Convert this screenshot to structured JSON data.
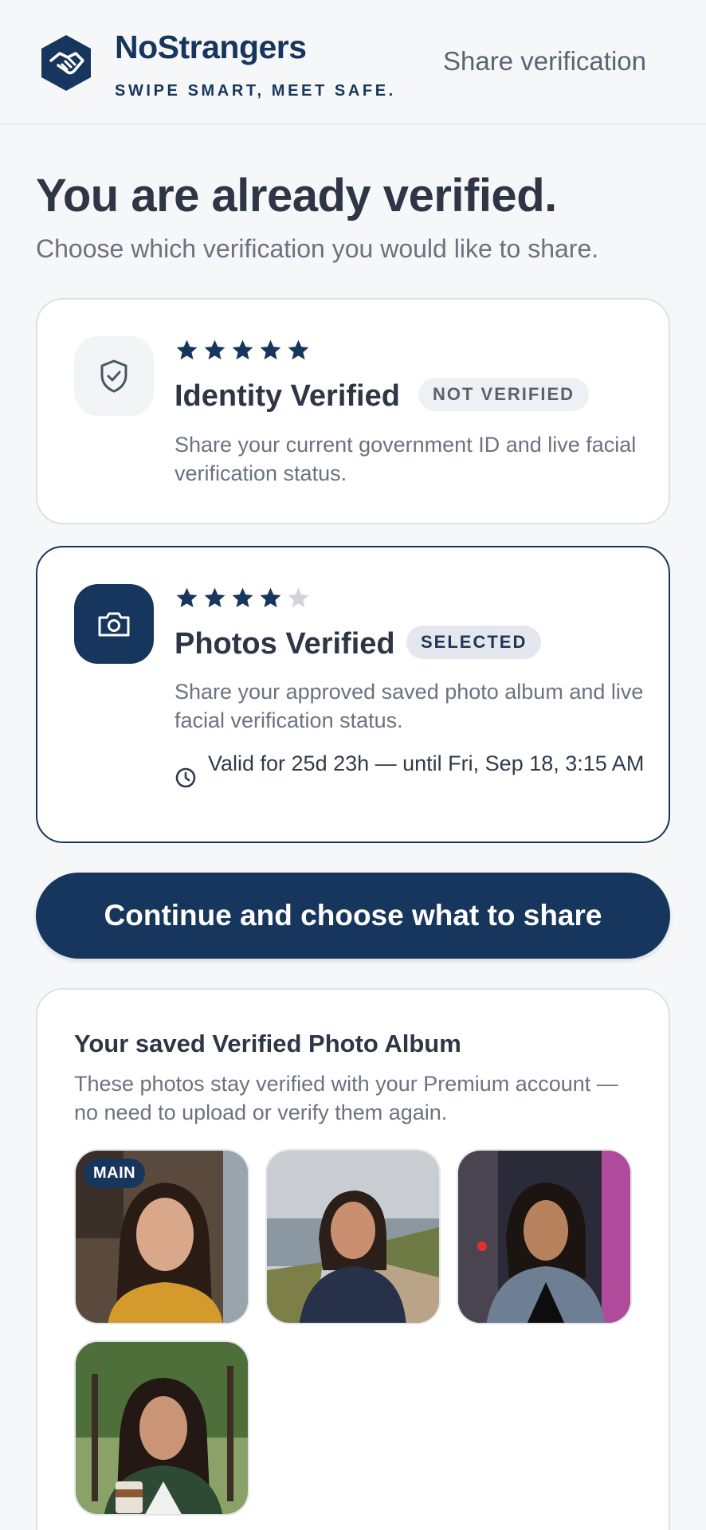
{
  "header": {
    "brand_name": "NoStrangers",
    "brand_tagline": "SWIPE SMART, MEET SAFE.",
    "share_link": "Share verification"
  },
  "main": {
    "title": "You are already verified.",
    "subtitle": "Choose which verification you would like to share."
  },
  "cards": [
    {
      "title": "Identity Verified",
      "badge": "NOT VERIFIED",
      "description": "Share your current government ID and live facial verification status.",
      "stars_filled": 5,
      "stars_total": 5,
      "icon": "shield-check-icon"
    },
    {
      "title": "Photos Verified",
      "badge": "SELECTED",
      "description": "Share your approved saved photo album and live facial verification status.",
      "valid_text": "Valid for 25d 23h — until Fri, Sep 18, 3:15 AM",
      "stars_filled": 4,
      "stars_total": 5,
      "icon": "camera-icon"
    }
  ],
  "cta_label": "Continue and choose what to share",
  "album": {
    "title": "Your saved Verified Photo Album",
    "description": "These photos stay verified with your Premium account — no need to upload or verify them again.",
    "main_badge": "MAIN",
    "photo_count": 4
  },
  "colors": {
    "brand": "#17365d",
    "background": "#f6f7f9",
    "muted_text": "#6b7280"
  }
}
